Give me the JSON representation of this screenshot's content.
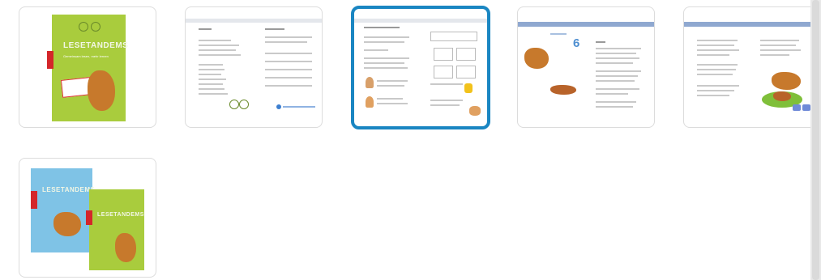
{
  "thumbnails": [
    {
      "name": "cover",
      "title": "LESETANDEMS",
      "subtitle": "Gemeinsam lesen, mehr lernen"
    },
    {
      "name": "contents-page"
    },
    {
      "name": "worksheet-page",
      "selected": true
    },
    {
      "name": "reading-page-dog",
      "big_number": "6"
    },
    {
      "name": "reading-page-dogs"
    },
    {
      "name": "double-cover",
      "title": "LESETANDEMS"
    }
  ],
  "colors": {
    "selection": "#1a86c2",
    "cover_green": "#a9cc3d",
    "cover_blue": "#7fc3e6"
  }
}
